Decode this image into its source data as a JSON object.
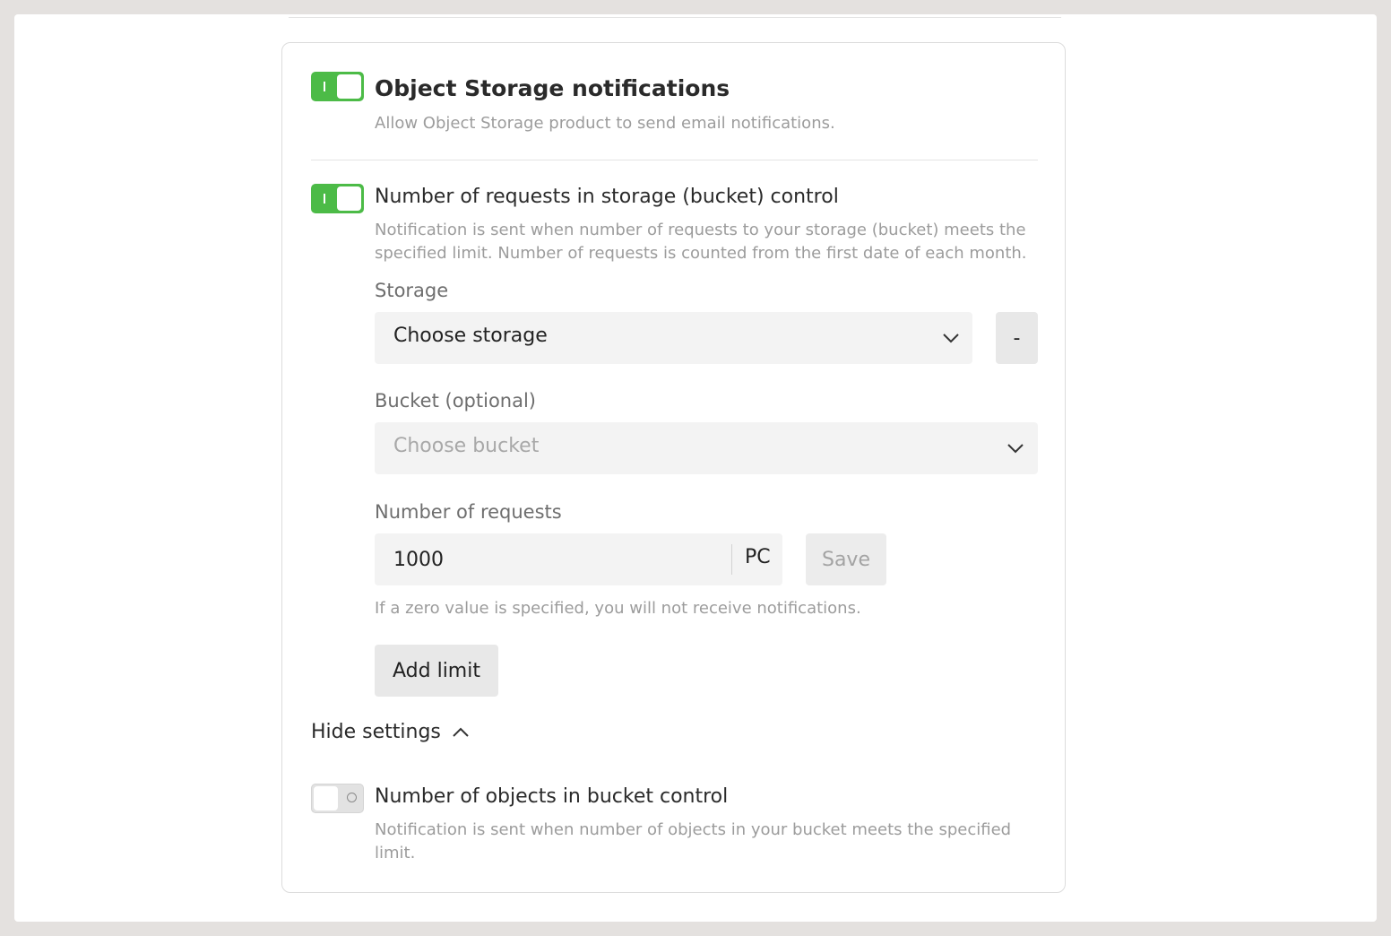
{
  "section": {
    "title": "Object Storage notifications",
    "description": "Allow Object Storage product to send email notifications.",
    "enabled": true
  },
  "requests_control": {
    "title": "Number of requests in storage (bucket) control",
    "description": "Notification is sent when number of requests to your storage (bucket) meets the specified limit. Number of requests is counted from the first date of each month.",
    "enabled": true,
    "storage_label": "Storage",
    "storage_value": "Choose storage",
    "remove_label": "-",
    "bucket_label": "Bucket (optional)",
    "bucket_placeholder": "Choose bucket",
    "requests_label": "Number of requests",
    "requests_value": "1000",
    "requests_unit": "PC",
    "save_label": "Save",
    "hint": "If a zero value is specified, you will not receive notifications.",
    "add_limit_label": "Add limit",
    "hide_settings_label": "Hide settings"
  },
  "objects_control": {
    "title": "Number of objects in bucket control",
    "description": "Notification is sent when number of objects in your bucket meets the specified limit.",
    "enabled": false
  },
  "icons": {
    "storage_dropdown": "chevron-down-icon",
    "bucket_dropdown": "chevron-down-icon",
    "hide_settings": "chevron-up-icon"
  },
  "colors": {
    "toggle_on": "#4cbb47",
    "toggle_off": "#e2e2e2"
  }
}
